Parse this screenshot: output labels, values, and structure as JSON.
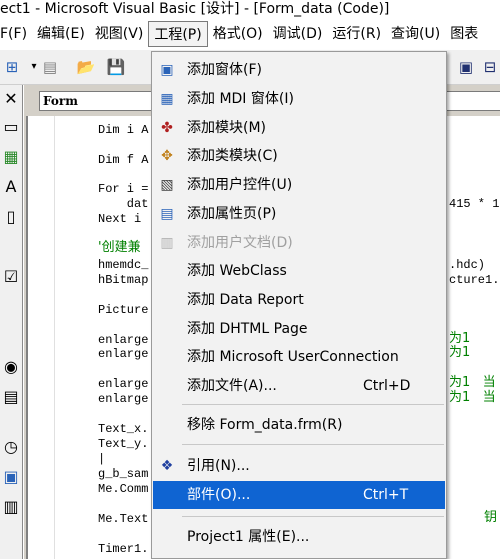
{
  "window": {
    "title": "ect1 - Microsoft Visual Basic [设计] - [Form_data (Code)]"
  },
  "menubar": {
    "items": [
      {
        "label": "F(F)"
      },
      {
        "label": "编辑(E)"
      },
      {
        "label": "视图(V)"
      },
      {
        "label": "工程(P)"
      },
      {
        "label": "格式(O)"
      },
      {
        "label": "调试(D)"
      },
      {
        "label": "运行(R)"
      },
      {
        "label": "查询(U)"
      },
      {
        "label": "图表"
      }
    ]
  },
  "code_window": {
    "object_combo": "Form",
    "lines": [
      "Dim i A",
      "Dim f A",
      "For i =",
      "    dat",
      "Next i",
      "'创建兼",
      "hmemdc_",
      "hBitmap",
      "Picture",
      "enlarge",
      "enlarge",
      "enlarge",
      "enlarge",
      "Text_x.",
      "Text_y.",
      "|",
      "g_b_sam",
      "Me.Comm",
      "Me.Text",
      "Timer1."
    ],
    "right_fragments": [
      "415 * 10",
      ".hdc)",
      "cture1.h",
      "为1",
      "为1",
      "为1   当",
      "为1   当",
      "钥"
    ]
  },
  "project_menu": {
    "items": [
      {
        "label": "添加窗体(F)",
        "icon": "form-icon",
        "shortcut": "",
        "disabled": false
      },
      {
        "label": "添加 MDI 窗体(I)",
        "icon": "mdi-form-icon",
        "shortcut": "",
        "disabled": false
      },
      {
        "label": "添加模块(M)",
        "icon": "module-icon",
        "shortcut": "",
        "disabled": false
      },
      {
        "label": "添加类模块(C)",
        "icon": "class-module-icon",
        "shortcut": "",
        "disabled": false
      },
      {
        "label": "添加用户控件(U)",
        "icon": "user-control-icon",
        "shortcut": "",
        "disabled": false
      },
      {
        "label": "添加属性页(P)",
        "icon": "property-page-icon",
        "shortcut": "",
        "disabled": false
      },
      {
        "label": "添加用户文档(D)",
        "icon": "user-document-icon",
        "shortcut": "",
        "disabled": true
      },
      {
        "label": "添加 WebClass",
        "icon": "",
        "shortcut": "",
        "disabled": false
      },
      {
        "label": "添加 Data Report",
        "icon": "",
        "shortcut": "",
        "disabled": false
      },
      {
        "label": "添加 DHTML Page",
        "icon": "",
        "shortcut": "",
        "disabled": false
      },
      {
        "label": "添加 Microsoft UserConnection",
        "icon": "",
        "shortcut": "",
        "disabled": false
      },
      {
        "label": "添加文件(A)...",
        "icon": "",
        "shortcut": "Ctrl+D",
        "disabled": false
      },
      {
        "label": "移除 Form_data.frm(R)",
        "icon": "",
        "shortcut": "",
        "disabled": false
      },
      {
        "label": "引用(N)...",
        "icon": "references-icon",
        "shortcut": "",
        "disabled": false
      },
      {
        "label": "部件(O)...",
        "icon": "",
        "shortcut": "Ctrl+T",
        "disabled": false,
        "highlighted": true
      },
      {
        "label": "Project1 属性(E)...",
        "icon": "",
        "shortcut": "",
        "disabled": false
      }
    ]
  },
  "colors": {
    "highlight": "#0f64d2",
    "comment": "#008000",
    "disabled": "#a0a0a0"
  }
}
